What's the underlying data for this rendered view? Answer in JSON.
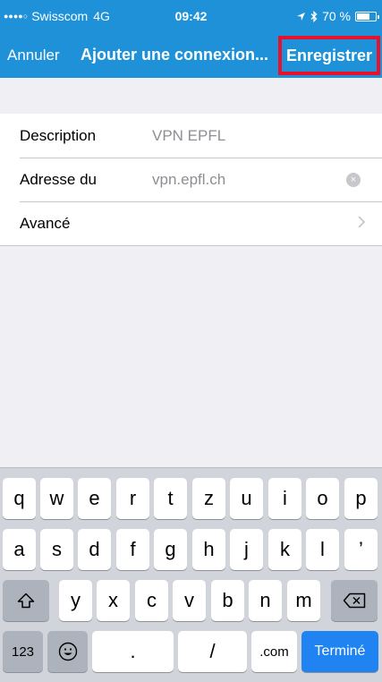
{
  "status_bar": {
    "signal_dots": "●●●●○",
    "carrier": "Swisscom",
    "network": "4G",
    "time": "09:42",
    "battery": "70 %",
    "battery_level": 0.7
  },
  "nav": {
    "cancel_label": "Annuler",
    "title": "Ajouter une connexion...",
    "save_label": "Enregistrer"
  },
  "form": {
    "rows": [
      {
        "label": "Description",
        "value": "VPN EPFL"
      },
      {
        "label": "Adresse du",
        "value": "vpn.epfl.ch"
      },
      {
        "label": "Avancé"
      }
    ]
  },
  "keyboard": {
    "row1": [
      "q",
      "w",
      "e",
      "r",
      "t",
      "z",
      "u",
      "i",
      "o",
      "p"
    ],
    "row2": [
      "a",
      "s",
      "d",
      "f",
      "g",
      "h",
      "j",
      "k",
      "l",
      "’"
    ],
    "row3": [
      "y",
      "x",
      "c",
      "v",
      "b",
      "n",
      "m"
    ],
    "numbers_label": "123",
    "dot_label": ".",
    "slash_label": "/",
    "com_label": ".com",
    "done_label": "Terminé"
  },
  "colors": {
    "header_bg": "#1e91d8",
    "highlight_border": "#e8112d",
    "done_key": "#1f83f1"
  },
  "icons": {
    "location": "location-arrow-icon",
    "bluetooth": "bluetooth-icon",
    "clear": "clear-circle-icon",
    "chevron": "chevron-right-icon",
    "shift": "shift-arrow-icon",
    "backspace": "backspace-icon",
    "emoji": "emoji-smiley-icon"
  }
}
